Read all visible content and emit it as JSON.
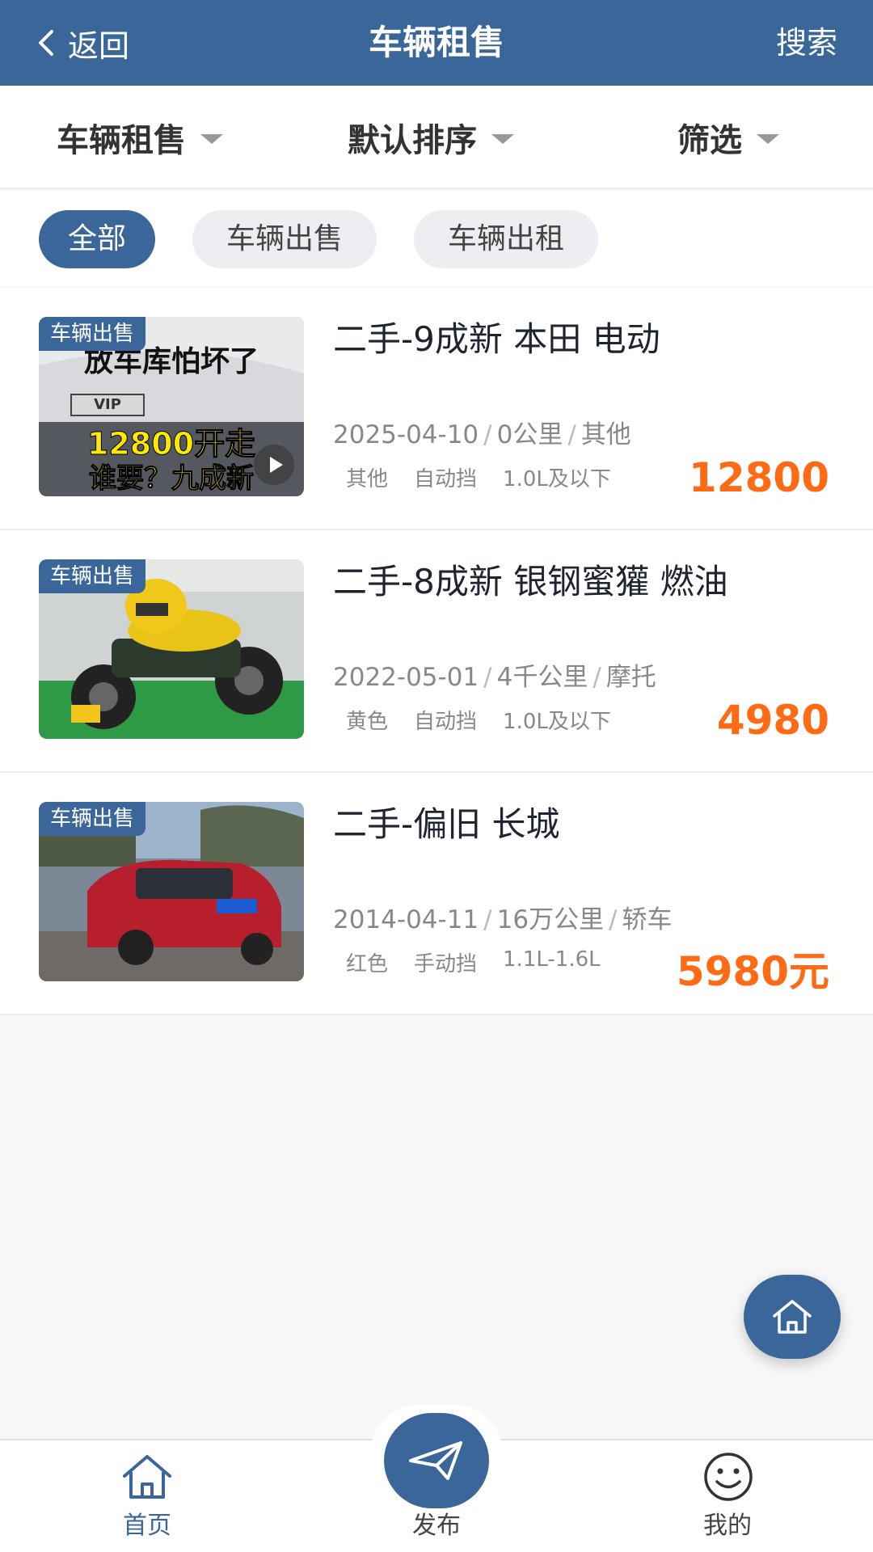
{
  "header": {
    "back_label": "返回",
    "title": "车辆租售",
    "search_label": "搜索"
  },
  "filters": [
    "车辆租售",
    "默认排序",
    "筛选"
  ],
  "chips": [
    {
      "label": "全部",
      "active": true
    },
    {
      "label": "车辆出售",
      "active": false
    },
    {
      "label": "车辆出租",
      "active": false
    }
  ],
  "listings": [
    {
      "badge": "车辆出售",
      "title": "二手-9成新 本田 电动",
      "date": "2025-04-10",
      "mileage": "0公里",
      "category": "其他",
      "tags": [
        "其他",
        "自动挡",
        "1.0L及以下"
      ],
      "price": "12800",
      "thumb_text": [
        "放车库怕坏了",
        "12800开走",
        "谁要？九成新"
      ],
      "plate_text": "VIP"
    },
    {
      "badge": "车辆出售",
      "title": "二手-8成新 银钢蜜獾 燃油",
      "date": "2022-05-01",
      "mileage": "4千公里",
      "category": "摩托",
      "tags": [
        "黄色",
        "自动挡",
        "1.0L及以下"
      ],
      "price": "4980"
    },
    {
      "badge": "车辆出售",
      "title": "二手-偏旧 长城",
      "date": "2014-04-11",
      "mileage": "16万公里",
      "category": "轿车",
      "tags": [
        "红色",
        "手动挡",
        "1.1L-1.6L"
      ],
      "price": "5980元"
    }
  ],
  "tabbar": {
    "home": "首页",
    "publish": "发布",
    "mine": "我的"
  },
  "colors": {
    "primary": "#3a6699",
    "price": "#ff6a14"
  }
}
